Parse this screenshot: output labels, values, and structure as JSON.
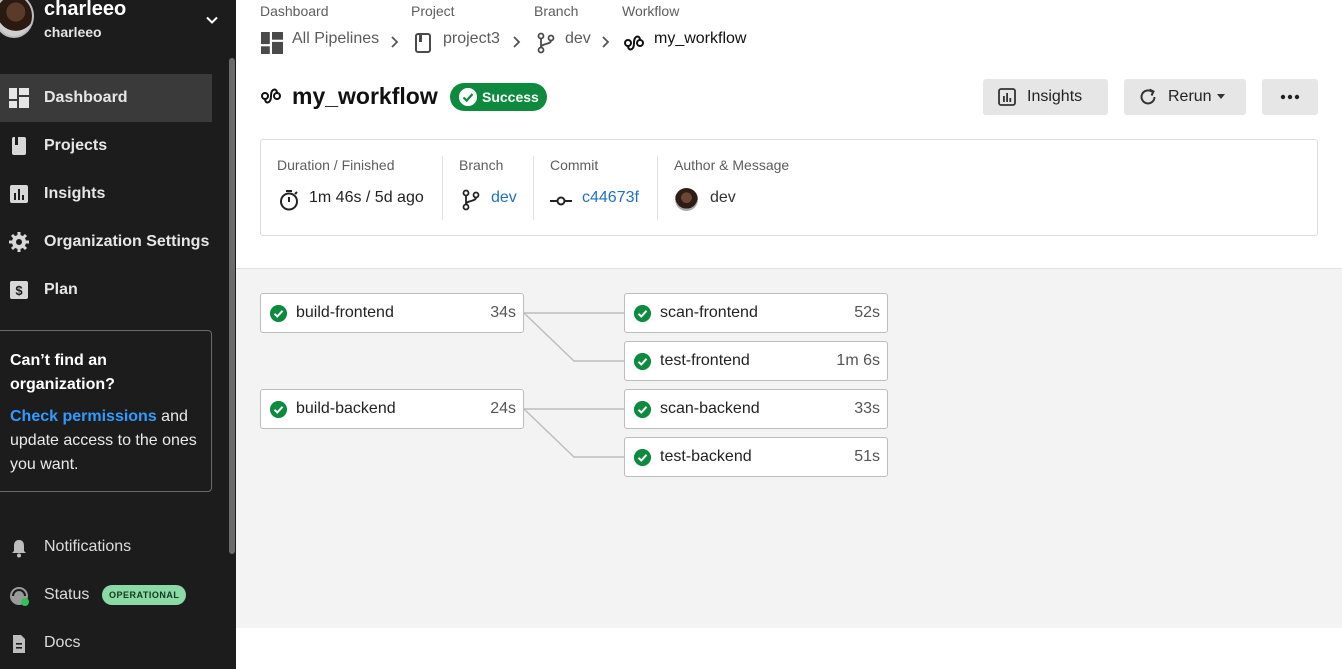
{
  "user": {
    "name": "charleeo",
    "handle": "charleeo"
  },
  "sidebar": {
    "items": [
      {
        "label": "Dashboard",
        "icon": "dashboard-icon"
      },
      {
        "label": "Projects",
        "icon": "book-icon"
      },
      {
        "label": "Insights",
        "icon": "bar-chart-icon"
      },
      {
        "label": "Organization Settings",
        "icon": "gear-icon"
      },
      {
        "label": "Plan",
        "icon": "dollar-icon"
      }
    ],
    "help": {
      "question": "Can’t find an organization?",
      "link": "Check permissions",
      "rest": " and update access to the ones you want."
    },
    "bottom": [
      {
        "label": "Notifications",
        "icon": "bell-icon"
      },
      {
        "label": "Status",
        "icon": "status-icon",
        "badge": "OPERATIONAL"
      },
      {
        "label": "Docs",
        "icon": "doc-icon"
      }
    ]
  },
  "breadcrumb": {
    "labels": [
      "Dashboard",
      "Project",
      "Branch",
      "Workflow"
    ],
    "items": [
      "All Pipelines",
      "project3",
      "dev",
      "my_workflow"
    ]
  },
  "workflow": {
    "title": "my_workflow",
    "status": "Success",
    "buttons": {
      "insights": "Insights",
      "rerun": "Rerun"
    }
  },
  "meta": {
    "duration_label": "Duration / Finished",
    "duration_value": "1m 46s / 5d ago",
    "branch_label": "Branch",
    "branch_value": "dev",
    "commit_label": "Commit",
    "commit_value": "c44673f",
    "author_label": "Author & Message",
    "author_message": "dev"
  },
  "jobs": [
    {
      "name": "build-frontend",
      "duration": "34s"
    },
    {
      "name": "scan-frontend",
      "duration": "52s"
    },
    {
      "name": "test-frontend",
      "duration": "1m 6s"
    },
    {
      "name": "build-backend",
      "duration": "24s"
    },
    {
      "name": "scan-backend",
      "duration": "33s"
    },
    {
      "name": "test-backend",
      "duration": "51s"
    }
  ],
  "colors": {
    "success": "#0e8a3f",
    "link": "#1f6fc7",
    "sidebar_bg": "#1c1c1c",
    "status_badge": "#8bd9a4"
  }
}
